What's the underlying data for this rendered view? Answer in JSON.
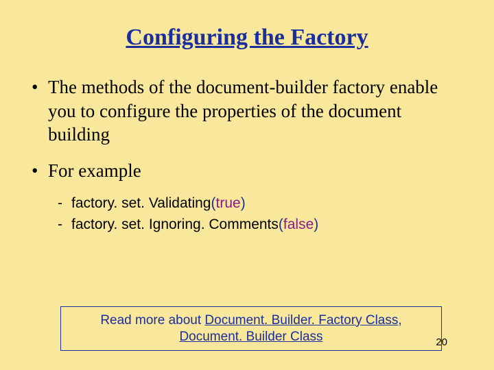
{
  "title": "Configuring the Factory",
  "bullets": {
    "item1": "The methods of the document-builder factory enable you to configure the properties of the document building",
    "item2": "For example"
  },
  "code": {
    "line1_pre": "factory. set. Validating",
    "open": "(",
    "true": "true",
    "close": ")",
    "line2_pre": "factory. set. Ignoring. Comments",
    "false": "false"
  },
  "footer": {
    "lead": "Read more about ",
    "link1": "Document. Builder. Factory Class",
    "sep": ", ",
    "link2": "Document. Builder Class"
  },
  "page_number": "20"
}
